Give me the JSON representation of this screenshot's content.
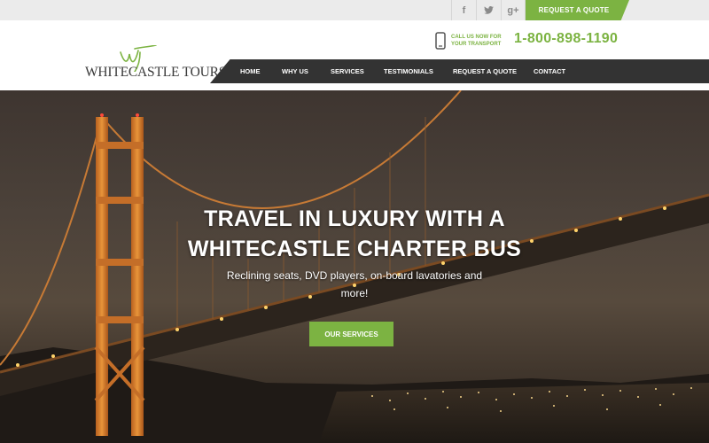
{
  "topbar": {
    "social": [
      {
        "icon": "facebook-icon",
        "glyph": "f"
      },
      {
        "icon": "twitter-icon",
        "glyph": ""
      },
      {
        "icon": "google-plus-icon",
        "glyph": "g+"
      }
    ],
    "request_quote_label": "REQUEST A QUOTE"
  },
  "header": {
    "logo_text": "WHITECASTLE TOURS",
    "call_label": "CALL US NOW FOR YOUR TRANSPORT",
    "phone_number": "1-800-898-1190"
  },
  "nav": {
    "items": [
      {
        "label": "HOME"
      },
      {
        "label": "WHY US"
      },
      {
        "label": "SERVICES"
      },
      {
        "label": "TESTIMONIALS"
      },
      {
        "label": "REQUEST A QUOTE"
      },
      {
        "label": "CONTACT"
      }
    ]
  },
  "hero": {
    "title_line1": "TRAVEL IN LUXURY WITH A",
    "title_line2": "WHITECASTLE CHARTER BUS",
    "subtitle": "Reclining seats, DVD players, on-board lavatories and more!",
    "button_label": "OUR SERVICES"
  },
  "colors": {
    "accent": "#7cb342",
    "nav_bg": "#333333",
    "topbar_bg": "#ebebeb"
  }
}
